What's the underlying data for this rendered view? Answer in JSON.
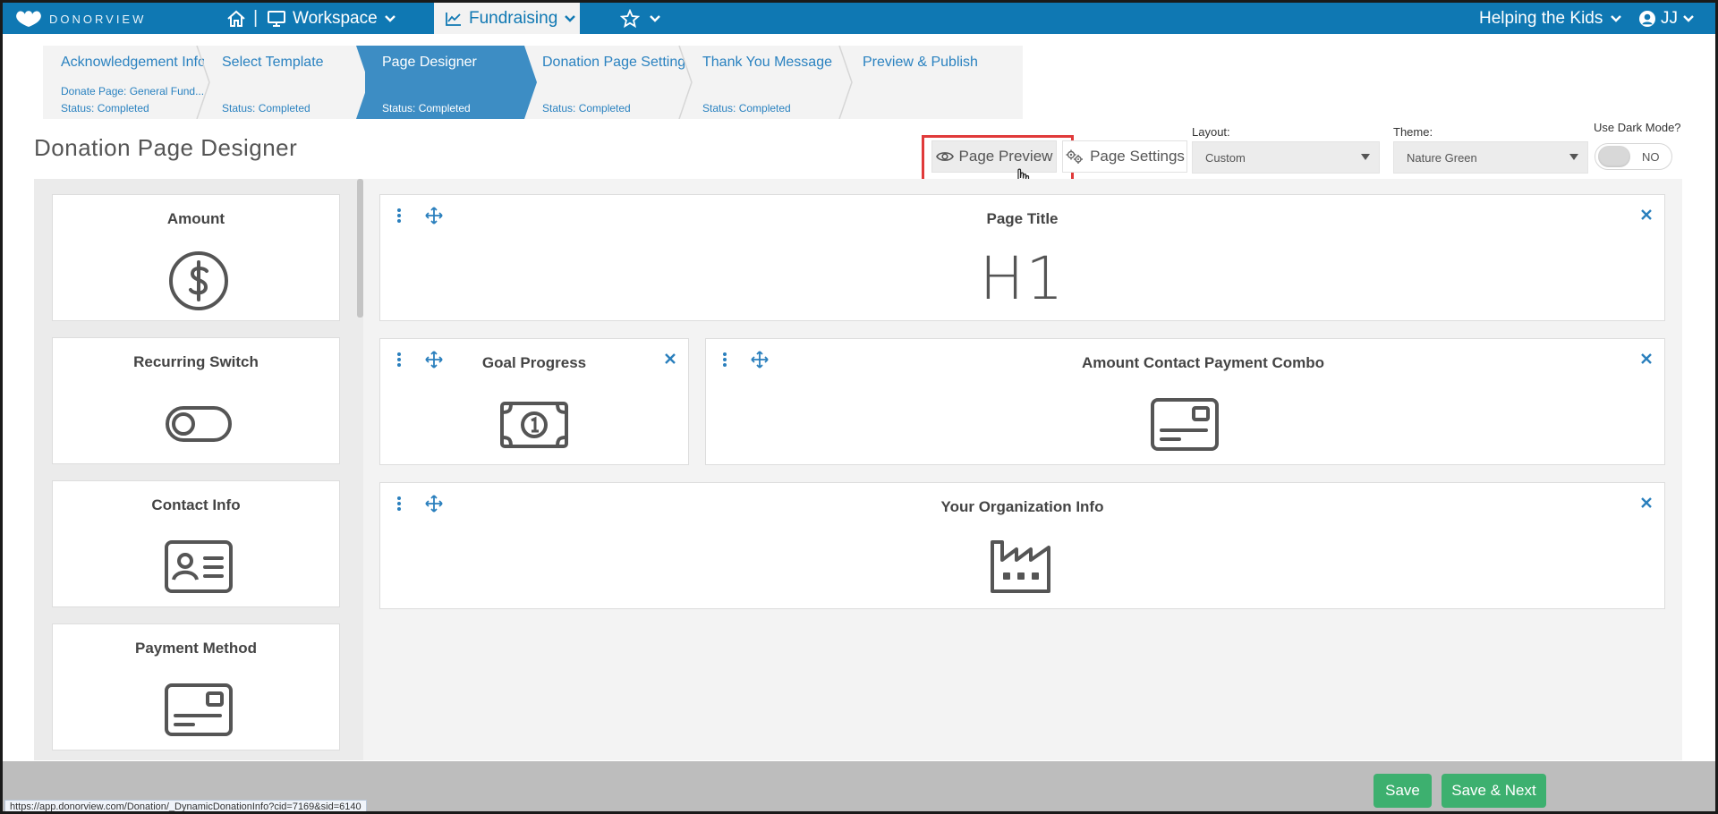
{
  "brand": {
    "name": "DONORVIEW",
    "nav_color": "#0f78b3",
    "accent": "#3d8dc4",
    "success": "#3db06f"
  },
  "topnav": {
    "home_icon": "home-icon",
    "separator": "|",
    "workspace_label": "Workspace",
    "fundraising_label": "Fundraising",
    "favorites_icon": "star-icon",
    "org_label": "Helping the Kids",
    "user_initials": "JJ"
  },
  "wizard": {
    "steps": [
      {
        "title": "Acknowledgement Info",
        "subtitle": "Donate Page: General Fund...",
        "status": "Status: Completed",
        "active": false
      },
      {
        "title": "Select Template",
        "subtitle": "",
        "status": "Status: Completed",
        "active": false
      },
      {
        "title": "Page Designer",
        "subtitle": "",
        "status": "Status: Completed",
        "active": true
      },
      {
        "title": "Donation Page Settings",
        "subtitle": "",
        "status": "Status: Completed",
        "active": false
      },
      {
        "title": "Thank You Message",
        "subtitle": "",
        "status": "Status: Completed",
        "active": false
      },
      {
        "title": "Preview & Publish",
        "subtitle": "",
        "status": "",
        "active": false
      }
    ]
  },
  "header": {
    "title": "Donation Page Designer",
    "preview_label": "Page Preview",
    "settings_label": "Page Settings",
    "layout_label": "Layout:",
    "layout_value": "Custom",
    "theme_label": "Theme:",
    "theme_value": "Nature Green",
    "dark_mode_label": "Use Dark Mode?",
    "dark_mode_value": "NO"
  },
  "palette": {
    "items": [
      {
        "label": "Amount",
        "icon": "dollar-circle-icon"
      },
      {
        "label": "Recurring Switch",
        "icon": "toggle-icon"
      },
      {
        "label": "Contact Info",
        "icon": "contact-card-icon"
      },
      {
        "label": "Payment Method",
        "icon": "credit-card-icon"
      }
    ]
  },
  "canvas": {
    "blocks": [
      {
        "title": "Page Title",
        "icon": "h1-heading-icon",
        "icon_text": "H1"
      },
      {
        "title": "Goal Progress",
        "icon": "banknote-icon"
      },
      {
        "title": "Amount Contact Payment Combo",
        "icon": "credit-card-icon"
      },
      {
        "title": "Your Organization Info",
        "icon": "factory-icon"
      }
    ]
  },
  "footer": {
    "save_label": "Save",
    "save_next_label": "Save & Next",
    "status_url": "https://app.donorview.com/Donation/_DynamicDonationInfo?cid=7169&sid=6140"
  }
}
